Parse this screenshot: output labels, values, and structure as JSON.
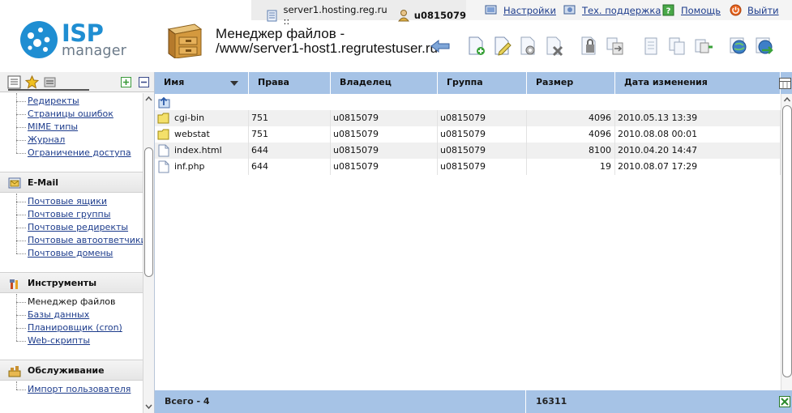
{
  "topbar": {
    "server": "server1.hosting.reg.ru ::",
    "user": "u0815079",
    "links": [
      {
        "label": "Настройки",
        "icon": "settings-icon"
      },
      {
        "label": "Тех. поддержка",
        "icon": "support-icon"
      },
      {
        "label": "Помощь",
        "icon": "help-icon"
      },
      {
        "label": "Выйти",
        "icon": "logout-icon"
      }
    ]
  },
  "logo": {
    "brand": "ISP",
    "product": "manager"
  },
  "page": {
    "title_line1": "Менеджер файлов -",
    "title_line2": "/www/server1-host1.regrutestuser.ru"
  },
  "sidebar": {
    "group_top": [
      {
        "label": "Редиректы"
      },
      {
        "label": "Страницы ошибок"
      },
      {
        "label": "MIME типы"
      },
      {
        "label": "Журнал"
      },
      {
        "label": "Ограничение доступа"
      }
    ],
    "sections": [
      {
        "title": "E-Mail",
        "icon": "mail-icon",
        "items": [
          {
            "label": "Почтовые ящики"
          },
          {
            "label": "Почтовые группы"
          },
          {
            "label": "Почтовые редиректы"
          },
          {
            "label": "Почтовые автоответчики"
          },
          {
            "label": "Почтовые домены"
          }
        ]
      },
      {
        "title": "Инструменты",
        "icon": "tools-icon",
        "items": [
          {
            "label": "Менеджер файлов",
            "current": true
          },
          {
            "label": "Базы данных"
          },
          {
            "label": "Планировщик (cron)"
          },
          {
            "label": "Web-скрипты"
          }
        ]
      },
      {
        "title": "Обслуживание",
        "icon": "maintenance-icon",
        "items": [
          {
            "label": "Импорт пользователя"
          }
        ]
      }
    ]
  },
  "table": {
    "columns": [
      "Имя",
      "Права",
      "Владелец",
      "Группа",
      "Размер",
      "Дата изменения"
    ],
    "rows": [
      {
        "type": "folder",
        "name": "cgi-bin",
        "perm": "751",
        "owner": "u0815079",
        "group": "u0815079",
        "size": "4096",
        "date": "2010.05.13 13:39"
      },
      {
        "type": "folder",
        "name": "webstat",
        "perm": "751",
        "owner": "u0815079",
        "group": "u0815079",
        "size": "4096",
        "date": "2010.08.08 00:01"
      },
      {
        "type": "file",
        "name": "index.html",
        "perm": "644",
        "owner": "u0815079",
        "group": "u0815079",
        "size": "8100",
        "date": "2010.04.20 14:47"
      },
      {
        "type": "file",
        "name": "inf.php",
        "perm": "644",
        "owner": "u0815079",
        "group": "u0815079",
        "size": "19",
        "date": "2010.08.07 17:29"
      }
    ],
    "footer": {
      "total": "Всего - 4",
      "size_total": "16311"
    }
  },
  "colors": {
    "header_blue": "#a6c3e6",
    "link_blue": "#1d3c8c",
    "brand_blue": "#1f8ed2",
    "row_alt": "#f0f0f0"
  }
}
